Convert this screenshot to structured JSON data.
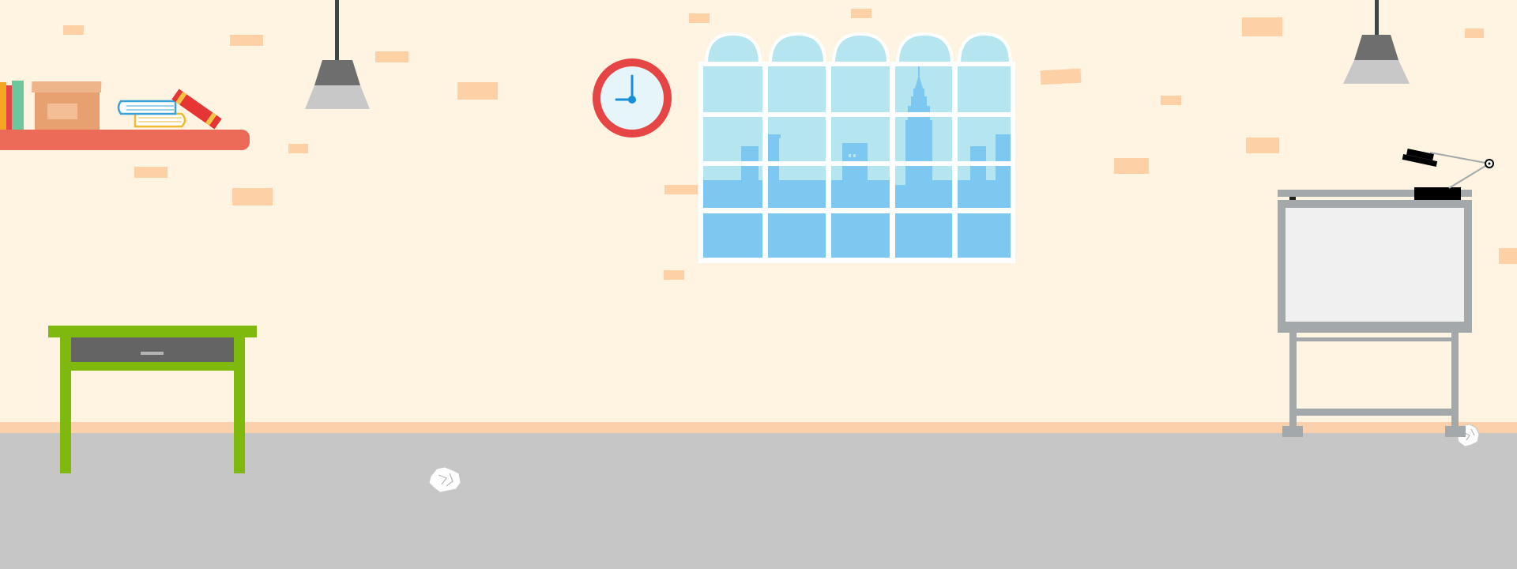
{
  "scene": {
    "type": "illustrated-room-background",
    "objects": [
      "wall-shelf",
      "books",
      "storage-box",
      "pendant-lamp",
      "wall-clock",
      "arched-window",
      "city-skyline",
      "green-desk",
      "crumpled-paper",
      "drafting-table",
      "desk-lamp"
    ]
  },
  "clock": {
    "hour": 9,
    "minute": 0
  },
  "colors": {
    "wall": "#fff3e1",
    "wall_bricks": "#fdd0a6",
    "baseboard": "#fbd0ab",
    "floor": "#c6c6c6",
    "shelf": "#ec6b58",
    "clock_rim": "#e64545",
    "clock_face": "#e6f5f9",
    "clock_hands": "#1890d8",
    "window_frame": "#ffffff",
    "sky": "#b5e6f0",
    "city": "#7dc8f0",
    "desk_frame": "#80b90d",
    "desk_drawer": "#646464",
    "lamp_shade_top": "#6e6e6e",
    "lamp_shade_bottom": "#c8c8c8",
    "drafting_table": "#a3a8ab",
    "drafting_board": "#f0f0f0",
    "box": "#e7a070"
  }
}
